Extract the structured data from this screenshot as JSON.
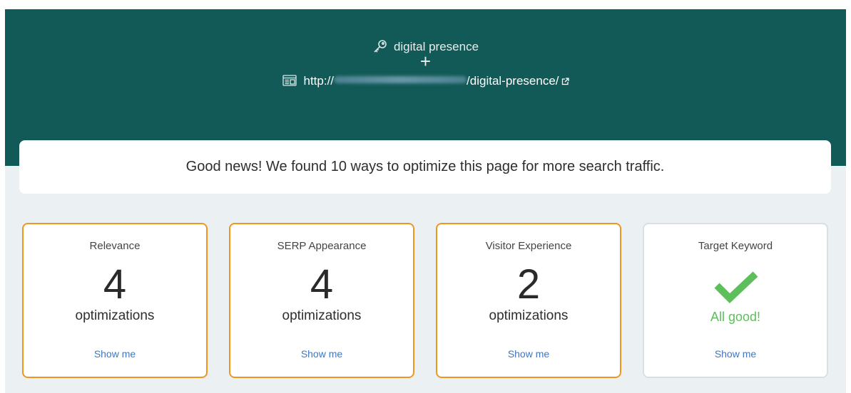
{
  "header": {
    "keyword": "digital presence",
    "plus": "+",
    "url_prefix": "http://",
    "url_path": "/digital-presence/"
  },
  "banner": {
    "message": "Good news! We found 10 ways to optimize this page for more search traffic."
  },
  "cards": [
    {
      "title": "Relevance",
      "count": "4",
      "unit": "optimizations",
      "link": "Show me"
    },
    {
      "title": "SERP Appearance",
      "count": "4",
      "unit": "optimizations",
      "link": "Show me"
    },
    {
      "title": "Visitor Experience",
      "count": "2",
      "unit": "optimizations",
      "link": "Show me"
    },
    {
      "title": "Target Keyword",
      "status": "All good!",
      "link": "Show me"
    }
  ],
  "colors": {
    "header_bg": "#125a57",
    "accent_border": "#f0961e",
    "link": "#3a78c8",
    "success": "#5cbf5c"
  },
  "icons": [
    "key-icon",
    "page-icon",
    "external-link-icon",
    "checkmark-icon"
  ]
}
